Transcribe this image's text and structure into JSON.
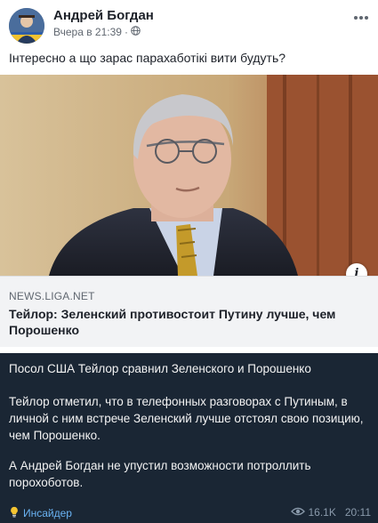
{
  "post": {
    "author": "Андрей Богдан",
    "timestamp": "Вчера в 21:39",
    "separator": "·",
    "visibility_icon": "globe-icon",
    "more_icon": "more-options-icon",
    "text": "Інтересно а що зарас парахаботікі вити будуть?"
  },
  "link_preview": {
    "info_label": "i",
    "domain": "NEWS.LIGA.NET",
    "title": "Тейлор: Зеленский противостоит Путину лучше, чем Порошенко"
  },
  "telegram": {
    "title": "Посол США Тейлор сравнил Зеленского и Порошенко",
    "body": "Тейлор отметил, что в телефонных разговорах с Путиным, в личной с ним встрече Зеленский лучше отстоял свою позицию, чем Порошенко.",
    "conclusion": "А Андрей Богдан не упустил возможности потроллить порохоботов.",
    "channel_icon": "lightbulb-icon",
    "channel": "Инсайдер",
    "views_icon": "eye-icon",
    "views": "16.1K",
    "time": "20:11"
  },
  "colors": {
    "telegram_bg": "#1a2634",
    "telegram_link": "#6ab3f3",
    "facebook_text": "#1d2129",
    "link_box_bg": "#f2f3f5"
  }
}
